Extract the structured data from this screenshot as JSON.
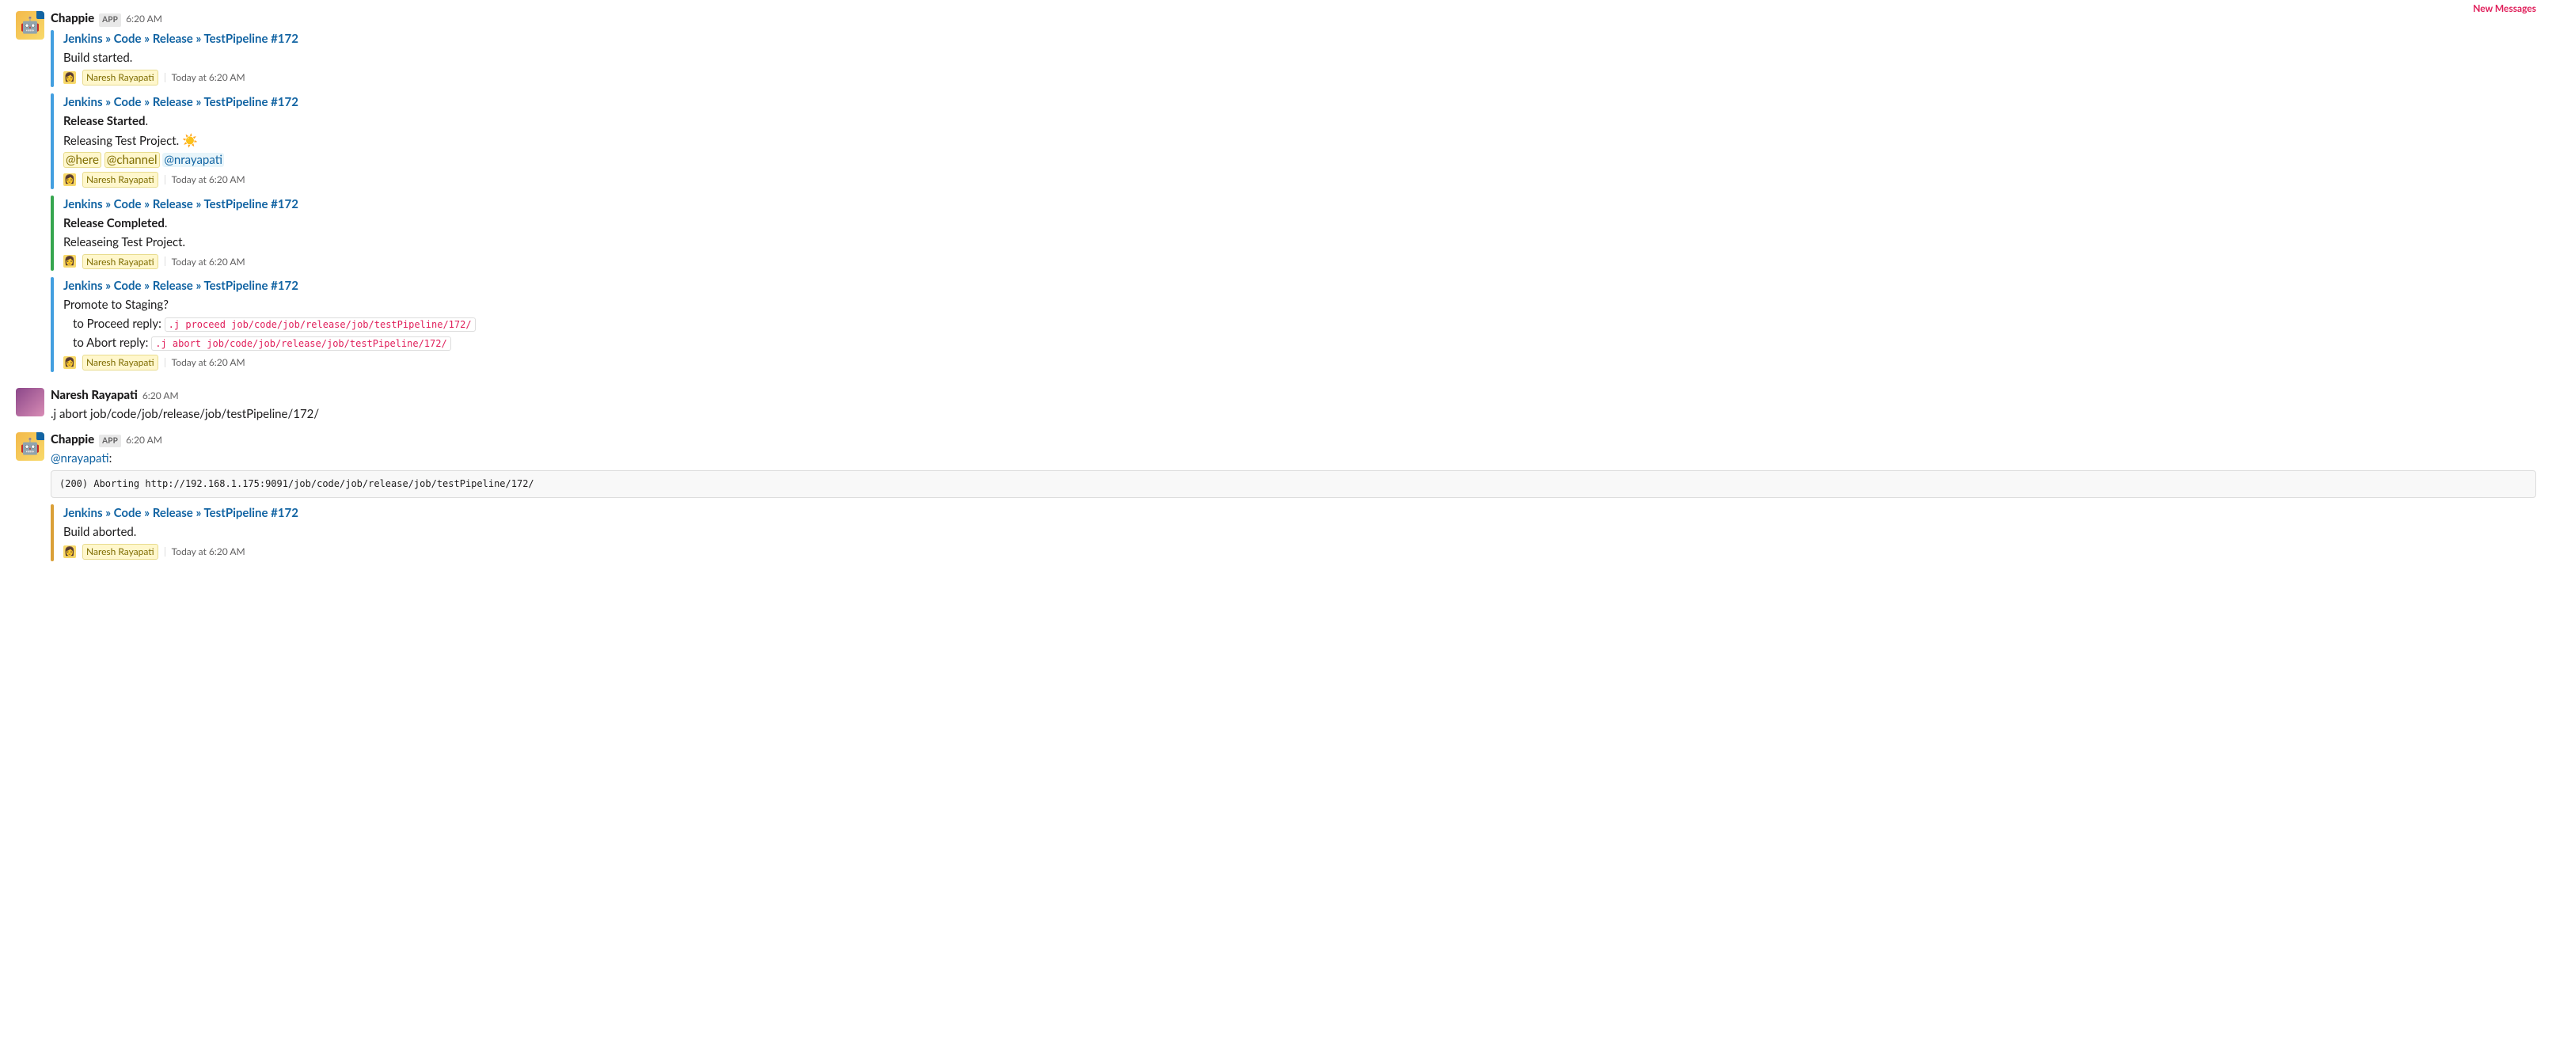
{
  "newMessagesLabel": "New Messages",
  "messages": [
    {
      "type": "app",
      "author": "Chappie",
      "appBadge": "APP",
      "time": "6:20 AM",
      "attachments": [
        {
          "color": "blue",
          "title": "Jenkins » Code » Release » TestPipeline #172",
          "lines": [
            {
              "plain": "Build started."
            }
          ],
          "footer": {
            "name": "Naresh Rayapati",
            "time": "Today at 6:20 AM"
          }
        },
        {
          "color": "blue",
          "title": "Jenkins » Code » Release » TestPipeline #172",
          "lines": [
            {
              "bold": "Release Started",
              "suffix": "."
            },
            {
              "plain": "Releasing Test Project. ",
              "emoji": "☀️"
            },
            {
              "mentions": [
                {
                  "type": "broadcast",
                  "text": "@here"
                },
                {
                  "type": "broadcast",
                  "text": "@channel"
                },
                {
                  "type": "user",
                  "text": "@nrayapati"
                }
              ]
            }
          ],
          "footer": {
            "name": "Naresh Rayapati",
            "time": "Today at 6:20 AM"
          }
        },
        {
          "color": "green",
          "title": "Jenkins » Code » Release » TestPipeline #172",
          "lines": [
            {
              "bold": "Release Completed",
              "suffix": "."
            },
            {
              "plain": "Releaseing Test Project."
            }
          ],
          "footer": {
            "name": "Naresh Rayapati",
            "time": "Today at 6:20 AM"
          }
        },
        {
          "color": "blue",
          "title": "Jenkins » Code » Release » TestPipeline #172",
          "lines": [
            {
              "plain": "Promote to Staging?"
            }
          ],
          "replies": [
            {
              "label": "to Proceed reply: ",
              "code": ".j proceed job/code/job/release/job/testPipeline/172/"
            },
            {
              "label": "to Abort reply: ",
              "code": ".j abort job/code/job/release/job/testPipeline/172/"
            }
          ],
          "footer": {
            "name": "Naresh Rayapati",
            "time": "Today at 6:20 AM"
          }
        }
      ]
    },
    {
      "type": "user",
      "author": "Naresh Rayapati",
      "time": "6:20 AM",
      "body": ".j abort job/code/job/release/job/testPipeline/172/"
    },
    {
      "type": "app",
      "author": "Chappie",
      "appBadge": "APP",
      "time": "6:20 AM",
      "bodyMention": "@nrayapati",
      "bodySuffix": ":",
      "codeBlock": "(200) Aborting http://192.168.1.175:9091/job/code/job/release/job/testPipeline/172/",
      "attachments": [
        {
          "color": "orange",
          "title": "Jenkins » Code » Release » TestPipeline #172",
          "lines": [
            {
              "plain": "Build aborted."
            }
          ],
          "footer": {
            "name": "Naresh Rayapati",
            "time": "Today at 6:20 AM"
          }
        }
      ]
    }
  ]
}
